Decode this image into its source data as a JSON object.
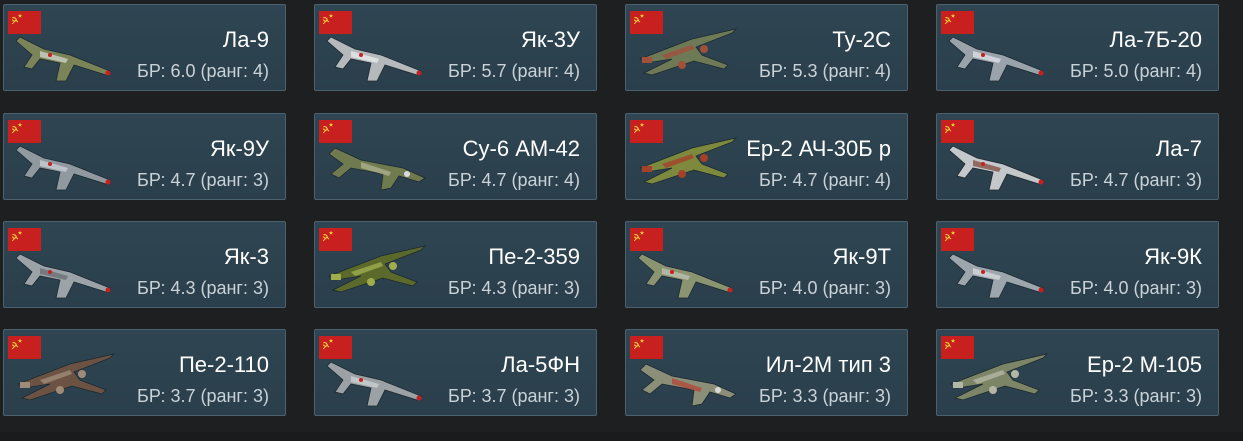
{
  "vehicles": [
    {
      "name": "Ла-9",
      "br": "БР: 6.0 (ранг: 4)",
      "plane_icon": "fighter-plane-icon",
      "camo": "#7b8458",
      "accent": "#c9cdbf"
    },
    {
      "name": "Як-3У",
      "br": "БР: 5.7 (ранг: 4)",
      "plane_icon": "fighter-plane-icon",
      "camo": "#b5b9bc",
      "accent": "#e3e6e8"
    },
    {
      "name": "Ту-2С",
      "br": "БР: 5.3 (ранг: 4)",
      "plane_icon": "bomber-plane-icon",
      "camo": "#6e7a56",
      "accent": "#a0503b"
    },
    {
      "name": "Ла-7Б-20",
      "br": "БР: 5.0 (ранг: 4)",
      "plane_icon": "fighter-plane-icon",
      "camo": "#9aa3ab",
      "accent": "#d7dde1"
    },
    {
      "name": "Як-9У",
      "br": "БР: 4.7 (ранг: 3)",
      "plane_icon": "fighter-plane-icon",
      "camo": "#8f999f",
      "accent": "#c3cad0"
    },
    {
      "name": "Су-6 АМ-42",
      "br": "БР: 4.7 (ранг: 4)",
      "plane_icon": "attacker-plane-icon",
      "camo": "#6f7a4e",
      "accent": "#a8ad8a"
    },
    {
      "name": "Ер-2 АЧ-30Б р",
      "br": "БР: 4.7 (ранг: 4)",
      "plane_icon": "bomber-plane-icon",
      "camo": "#7d8a3e",
      "accent": "#a5402b"
    },
    {
      "name": "Ла-7",
      "br": "БР: 4.7 (ранг: 3)",
      "plane_icon": "fighter-plane-icon",
      "camo": "#c4c8cb",
      "accent": "#8a5b4e"
    },
    {
      "name": "Як-3",
      "br": "БР: 4.3 (ранг: 3)",
      "plane_icon": "fighter-plane-icon",
      "camo": "#9ca3a8",
      "accent": "#6d7377"
    },
    {
      "name": "Пе-2-359",
      "br": "БР: 4.3 (ранг: 3)",
      "plane_icon": "bomber-plane-icon",
      "camo": "#5b6a2b",
      "accent": "#9fae4b"
    },
    {
      "name": "Як-9Т",
      "br": "БР: 4.0 (ранг: 3)",
      "plane_icon": "fighter-plane-icon",
      "camo": "#8a9470",
      "accent": "#b8bcae"
    },
    {
      "name": "Як-9К",
      "br": "БР: 4.0 (ранг: 3)",
      "plane_icon": "fighter-plane-icon",
      "camo": "#9ea6ad",
      "accent": "#d0d5d9"
    },
    {
      "name": "Пе-2-110",
      "br": "БР: 3.7 (ранг: 3)",
      "plane_icon": "bomber-plane-icon",
      "camo": "#6b5242",
      "accent": "#a08b78"
    },
    {
      "name": "Ла-5ФН",
      "br": "БР: 3.7 (ранг: 3)",
      "plane_icon": "fighter-plane-icon",
      "camo": "#9ba1a4",
      "accent": "#c8cdcf"
    },
    {
      "name": "Ил-2М тип 3",
      "br": "БР: 3.3 (ранг: 3)",
      "plane_icon": "attacker-plane-icon",
      "camo": "#8b8f78",
      "accent": "#b04d3c"
    },
    {
      "name": "Ер-2 М-105",
      "br": "БР: 3.3 (ранг: 3)",
      "plane_icon": "bomber-plane-icon",
      "camo": "#7c8565",
      "accent": "#b4b7a5"
    }
  ],
  "flag_icon": "ussr-flag-icon",
  "colors": {
    "card_bg": "#2f4552",
    "card_border": "#4a6270",
    "flag_red": "#c8201e",
    "name_text": "#ffffff",
    "br_text": "#c9d2d8"
  }
}
